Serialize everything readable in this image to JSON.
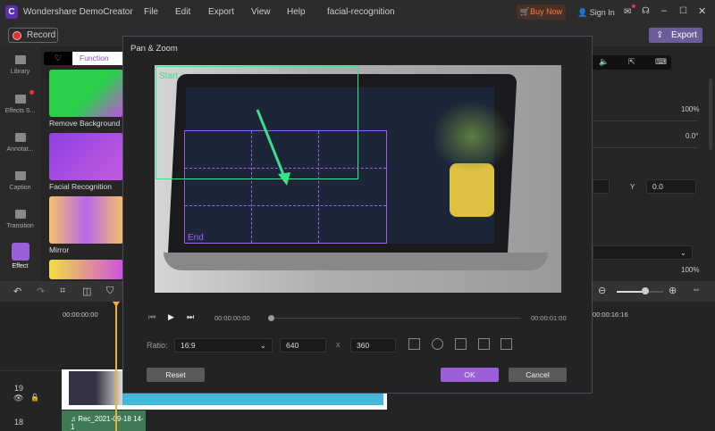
{
  "app": {
    "title": "Wondershare DemoCreator",
    "project": "facial-recognition",
    "menu": [
      "File",
      "Edit",
      "Export",
      "View",
      "Help"
    ],
    "buy_now": "Buy Now",
    "sign_in": "Sign In",
    "accent": "#9b5fd9"
  },
  "toolbar": {
    "record": "Record",
    "export": "Export"
  },
  "sidebar": {
    "items": [
      {
        "label": "Library",
        "icon": "folder-icon"
      },
      {
        "label": "Effects S...",
        "icon": "store-icon"
      },
      {
        "label": "Annotat...",
        "icon": "annotation-icon"
      },
      {
        "label": "Caption",
        "icon": "caption-icon"
      },
      {
        "label": "Transition",
        "icon": "transition-icon"
      },
      {
        "label": "Effect",
        "icon": "magic-wand-icon",
        "active": true
      }
    ]
  },
  "panel": {
    "tab": "Function",
    "items": [
      "Remove Background",
      "Facial Recognition",
      "Mirror"
    ]
  },
  "dialog": {
    "title": "Pan & Zoom",
    "start_label": "Start",
    "end_label": "End",
    "time_current": "00:00:00:00",
    "time_end": "00:00:01:00",
    "ratio_label": "Ratio:",
    "ratio_value": "16:9",
    "width": "640",
    "x_sep": "x",
    "height": "360",
    "reset": "Reset",
    "ok": "OK",
    "cancel": "Cancel"
  },
  "right": {
    "v1": "100%",
    "v2": "0.0°",
    "y_label": "Y",
    "y_value": "0.0",
    "v3": "100%"
  },
  "timeline": {
    "time_start": "00:00:00:00",
    "time_right": "00:00:16:16",
    "track19": "19",
    "track18": "18",
    "audio_clip": "Rec_2021-09-18 14-1"
  }
}
